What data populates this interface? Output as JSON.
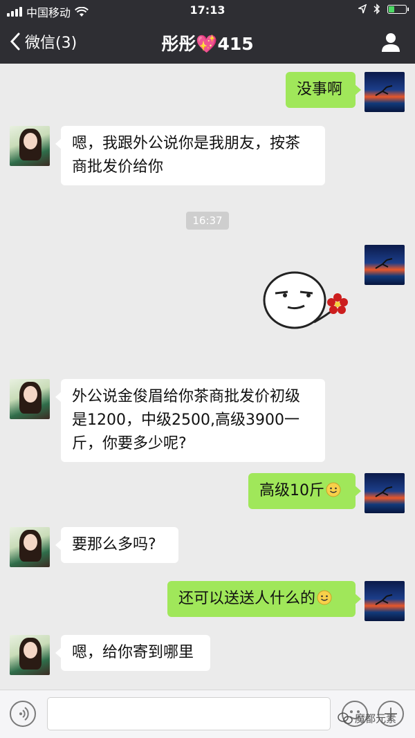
{
  "status_bar": {
    "carrier": "中国移动",
    "time": "17:13"
  },
  "nav": {
    "back_label": "微信(3)",
    "title_name": "彤彤",
    "title_heart": "💖",
    "title_suffix": "415"
  },
  "messages": [
    {
      "side": "right",
      "text": "没事啊"
    },
    {
      "side": "left",
      "text": "嗯，我跟外公说你是我朋友，按茶商批发价给你"
    },
    {
      "side": "timestamp",
      "text": "16:37"
    },
    {
      "side": "right",
      "type": "sticker",
      "icon": "smirk-face-with-flower-sticker"
    },
    {
      "side": "left",
      "text": "外公说金俊眉给你茶商批发价初级是1200，中级2500,高级3900一斤，你要多少呢?"
    },
    {
      "side": "right",
      "text": "高级10斤",
      "emoji": "smile-emoji"
    },
    {
      "side": "left",
      "text": "要那么多吗?"
    },
    {
      "side": "right",
      "text": "还可以送送人什么的",
      "emoji": "smile-emoji"
    },
    {
      "side": "left",
      "text": "嗯，给你寄到哪里"
    }
  ],
  "input_bar": {
    "placeholder": ""
  },
  "watermark": {
    "text": "魔都元素"
  },
  "colors": {
    "nav_bg": "#2e2e33",
    "chat_bg": "#ebebeb",
    "bubble_self": "#a0e75a",
    "bubble_other": "#ffffff"
  }
}
